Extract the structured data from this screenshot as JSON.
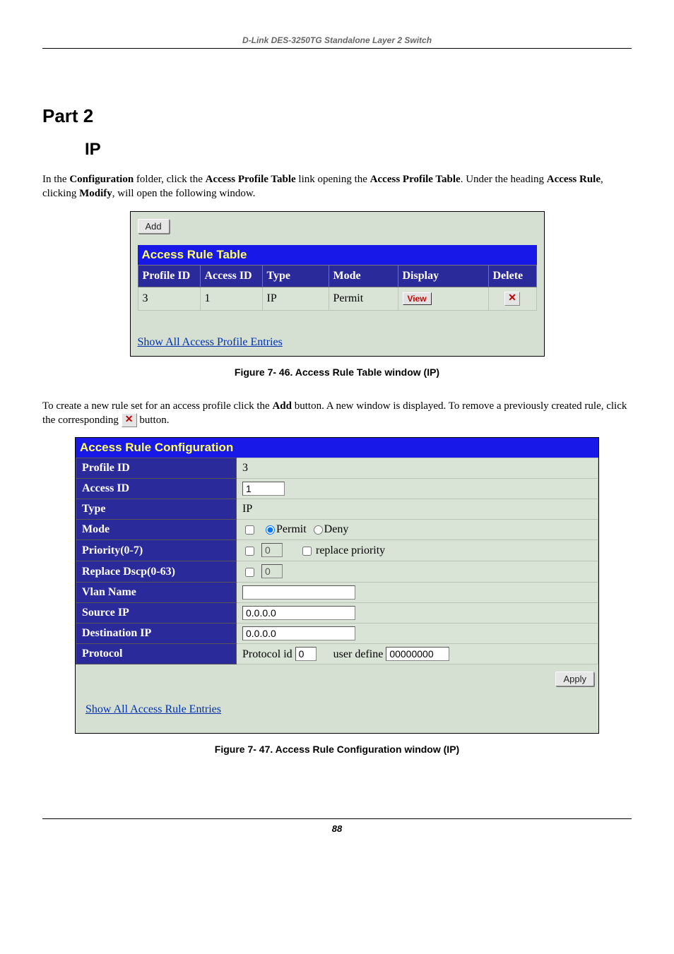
{
  "doc_header": "D-Link DES-3250TG Standalone Layer 2 Switch",
  "part_heading": "Part 2",
  "ip_heading": "IP",
  "intro_segments": {
    "s1": "In the ",
    "s2": "Configuration",
    "s3": " folder, click the ",
    "s4": "Access Profile Table",
    "s5": " link opening the ",
    "s6": "Access Profile Table",
    "s7": ". Under the heading ",
    "s8": "Access Rule",
    "s9": ", clicking ",
    "s10": "Modify",
    "s11": ", will open the following window."
  },
  "fig1": {
    "add_label": "Add",
    "title": "Access Rule Table",
    "headers": {
      "profile_id": "Profile ID",
      "access_id": "Access ID",
      "type": "Type",
      "mode": "Mode",
      "display": "Display",
      "delete": "Delete"
    },
    "row": {
      "profile_id": "3",
      "access_id": "1",
      "type": "IP",
      "mode": "Permit",
      "view_label": "View"
    },
    "footer_link": "Show All Access Profile Entries",
    "caption": "Figure 7- 46. Access Rule Table window (IP)"
  },
  "mid_segments": {
    "s1": "To create a new rule set for an access profile click the ",
    "s2": "Add",
    "s3": " button. A new window is displayed. To remove a previously created rule, click the corresponding ",
    "s4": " button."
  },
  "fig2": {
    "title": "Access Rule Configuration",
    "labels": {
      "profile_id": "Profile ID",
      "access_id": "Access ID",
      "type": "Type",
      "mode": "Mode",
      "priority": "Priority(0-7)",
      "replace_dscp": "Replace Dscp(0-63)",
      "vlan_name": "Vlan Name",
      "source_ip": "Source IP",
      "dest_ip": "Destination IP",
      "protocol": "Protocol"
    },
    "values": {
      "profile_id": "3",
      "access_id": "1",
      "type": "IP",
      "mode_permit": "Permit",
      "mode_deny": "Deny",
      "priority_value": "0",
      "replace_priority_label": "replace priority",
      "replace_dscp_value": "0",
      "vlan_name": "",
      "source_ip": "0.0.0.0",
      "dest_ip": "0.0.0.0",
      "protocol_id_label": "Protocol id",
      "protocol_id_value": "0",
      "user_define_label": "user define",
      "user_define_value": "00000000"
    },
    "apply_label": "Apply",
    "footer_link": "Show All Access Rule Entries",
    "caption": "Figure 7- 47. Access Rule Configuration window (IP)"
  },
  "page_number": "88"
}
